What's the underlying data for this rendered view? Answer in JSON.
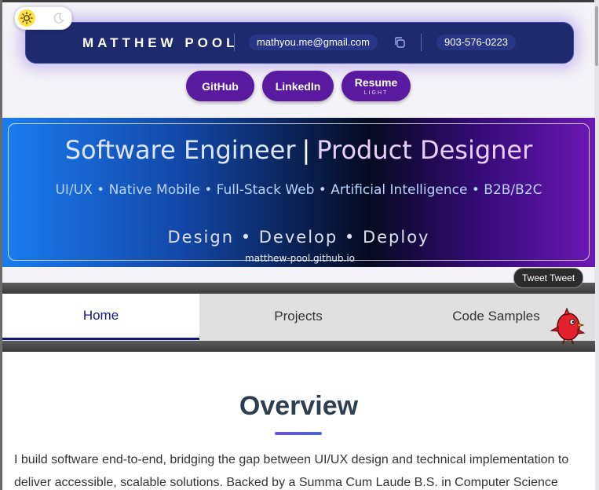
{
  "header": {
    "name": "MATTHEW POOL",
    "email": "mathyou.me@gmail.com",
    "phone": "903-576-0223"
  },
  "links": {
    "github": "GitHub",
    "linkedin": "LinkedIn",
    "resume": "Resume",
    "resume_sub": "LIGHT"
  },
  "banner": {
    "title_left": "Software Engineer",
    "title_divider": "|",
    "title_right": "Product Designer",
    "subtitle": "UI/UX • Native Mobile • Full-Stack Web • Artificial Intelligence • B2B/B2C",
    "tagline": "Design • Develop • Deploy",
    "url": "matthew-pool.github.io"
  },
  "tweet_label": "Tweet Tweet",
  "tabs": [
    {
      "label": "Home",
      "active": true
    },
    {
      "label": "Projects",
      "active": false
    },
    {
      "label": "Code Samples",
      "active": false
    }
  ],
  "content": {
    "heading": "Overview",
    "paragraph": "I build software end-to-end, bridging the gap between UI/UX design and technical implementation to deliver accessible, scalable solutions. Backed by a Summa Cum Laude B.S. in Computer Science"
  },
  "icons": {
    "theme_light": "sun-icon",
    "theme_dark": "moon-icon",
    "copy": "copy-icon",
    "mascot": "bird-icon"
  },
  "colors": {
    "header_bg": "#1f2a6e",
    "button_bg": "#5a1aa0",
    "active_tab": "#141480",
    "heading": "#2c3e50"
  }
}
